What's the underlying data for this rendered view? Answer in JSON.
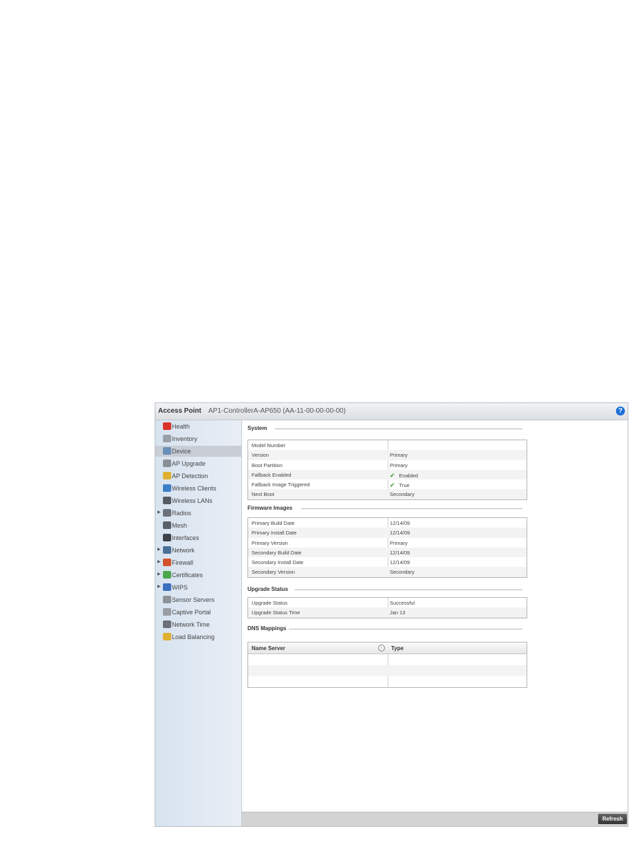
{
  "header": {
    "title": "Access Point",
    "device": "AP1-ControllerA-AP650 (AA-11-00-00-00-00)",
    "help": "?"
  },
  "sidebar": {
    "items": [
      {
        "label": "Health",
        "icon": "health-icon",
        "color": "#d8322a",
        "arrow": ""
      },
      {
        "label": "Inventory",
        "icon": "inventory-icon",
        "color": "#9aa0a8",
        "arrow": ""
      },
      {
        "label": "Device",
        "icon": "device-icon",
        "color": "#6a8fb8",
        "arrow": ""
      },
      {
        "label": "AP Upgrade",
        "icon": "ap-upgrade-icon",
        "color": "#8a8f96",
        "arrow": ""
      },
      {
        "label": "AP Detection",
        "icon": "ap-detection-icon",
        "color": "#e0b030",
        "arrow": ""
      },
      {
        "label": "Wireless Clients",
        "icon": "wireless-clients-icon",
        "color": "#3b7fc9",
        "arrow": ""
      },
      {
        "label": "Wireless LANs",
        "icon": "wireless-lans-icon",
        "color": "#555b63",
        "arrow": ""
      },
      {
        "label": "Radios",
        "icon": "radios-icon",
        "color": "#6b7079",
        "arrow": "▶"
      },
      {
        "label": "Mesh",
        "icon": "mesh-icon",
        "color": "#5a6068",
        "arrow": ""
      },
      {
        "label": "Interfaces",
        "icon": "interfaces-icon",
        "color": "#3e434a",
        "arrow": ""
      },
      {
        "label": "Network",
        "icon": "network-icon",
        "color": "#4b6f96",
        "arrow": "▶"
      },
      {
        "label": "Firewall",
        "icon": "firewall-icon",
        "color": "#d2522c",
        "arrow": "▶"
      },
      {
        "label": "Certificates",
        "icon": "certificates-icon",
        "color": "#4aa64a",
        "arrow": "▶"
      },
      {
        "label": "WIPS",
        "icon": "wips-icon",
        "color": "#3a6fc0",
        "arrow": "▶"
      },
      {
        "label": "Sensor Servers",
        "icon": "sensor-servers-icon",
        "color": "#8d9299",
        "arrow": ""
      },
      {
        "label": "Captive Portal",
        "icon": "captive-portal-icon",
        "color": "#9a9ea4",
        "arrow": ""
      },
      {
        "label": "Network Time",
        "icon": "network-time-icon",
        "color": "#6b7079",
        "arrow": ""
      },
      {
        "label": "Load Balancing",
        "icon": "load-balancing-icon",
        "color": "#e0b030",
        "arrow": ""
      }
    ],
    "active_index": 2
  },
  "system": {
    "title": "System",
    "rows": [
      {
        "key": "Model Number",
        "value": ""
      },
      {
        "key": "Version",
        "value": "Primary"
      },
      {
        "key": "Boot Partition",
        "value": "Primary"
      },
      {
        "key": "Fallback Enabled",
        "value": "Enabled",
        "check": "✔"
      },
      {
        "key": "Fallback Image Triggered",
        "value": "True",
        "check": "✔"
      },
      {
        "key": "Next Boot",
        "value": "Secondary"
      }
    ]
  },
  "firmware": {
    "title": "Firmware Images",
    "rows": [
      {
        "key": "Primary Build Date",
        "value": "12/14/09"
      },
      {
        "key": "Primary Install Date",
        "value": "12/14/09"
      },
      {
        "key": "Primary Version",
        "value": "Primary"
      },
      {
        "key": "Secondary Build Date",
        "value": "12/14/09"
      },
      {
        "key": "Secondary Install Date",
        "value": "12/14/09"
      },
      {
        "key": "Secondary Version",
        "value": "Secondary"
      }
    ]
  },
  "upgrade": {
    "title": "Upgrade Status",
    "rows": [
      {
        "key": "Upgrade Status",
        "value": "Successful"
      },
      {
        "key": "Upgrade Status Time",
        "value": "Jan 13"
      }
    ]
  },
  "dns": {
    "title": "DNS Mappings",
    "columns": [
      "Name Server",
      "Type"
    ],
    "rows": 3
  },
  "footer": {
    "refresh_label": "Refresh"
  }
}
